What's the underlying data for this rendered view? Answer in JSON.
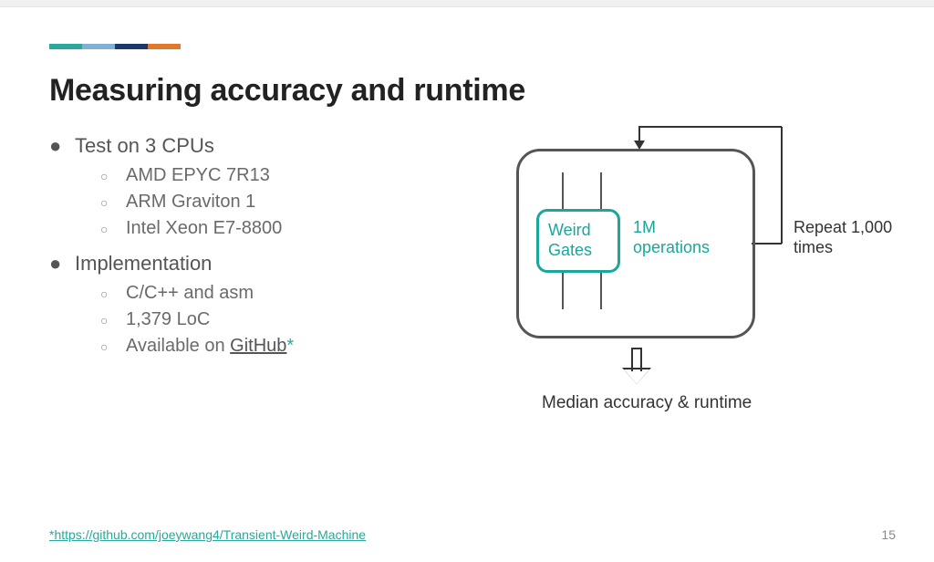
{
  "title": "Measuring accuracy and runtime",
  "bullets": {
    "cpus": {
      "heading": "Test on 3 CPUs",
      "items": [
        "AMD EPYC 7R13",
        "ARM Graviton 1",
        "Intel Xeon E7-8800"
      ]
    },
    "impl": {
      "heading": "Implementation",
      "items": [
        "C/C++ and asm",
        "1,379 LoC"
      ],
      "github_prefix": "Available on ",
      "github_text": "GitHub",
      "github_asterisk": "*"
    }
  },
  "diagram": {
    "inner_box_l1": "Weird",
    "inner_box_l2": "Gates",
    "one_m_l1": "1M",
    "one_m_l2": "operations",
    "repeat_l1": "Repeat 1,000",
    "repeat_l2": "times",
    "median": "Median accuracy & runtime"
  },
  "footer": {
    "link": "*https://github.com/joeywang4/Transient-Weird-Machine",
    "page": "15"
  }
}
